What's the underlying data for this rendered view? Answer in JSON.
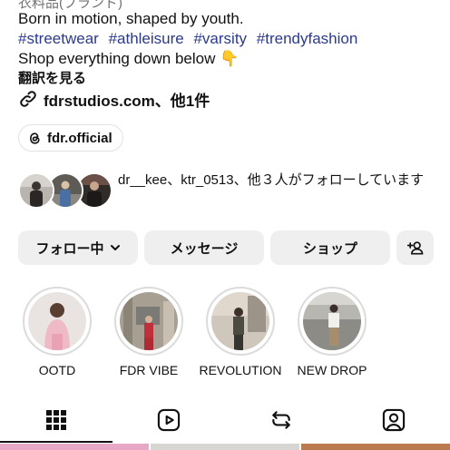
{
  "profile": {
    "category": "衣料品(ブランド)",
    "bio_line1": "Born in motion, shaped by youth.",
    "hashtags": [
      "#streetwear",
      "#athleisure",
      "#varsity",
      "#trendyfashion"
    ],
    "bio_line3": "Shop everything down below",
    "bio_emoji": "👇",
    "translate_label": "翻訳を見る",
    "link_text": "fdrstudios.com、他1件",
    "threads_label": "fdr.official"
  },
  "followers": {
    "text": "dr__kee、ktr_0513、他３人がフォローしています"
  },
  "buttons": {
    "following": "フォロー中",
    "message": "メッセージ",
    "shop": "ショップ"
  },
  "highlights": [
    {
      "label": "OOTD"
    },
    {
      "label": "FDR VIBE"
    },
    {
      "label": "REVOLUTION"
    },
    {
      "label": "NEW DROP"
    }
  ],
  "tabs": [
    {
      "icon": "grid-icon"
    },
    {
      "icon": "reels-icon"
    },
    {
      "icon": "reposts-icon"
    },
    {
      "icon": "tagged-icon"
    }
  ]
}
